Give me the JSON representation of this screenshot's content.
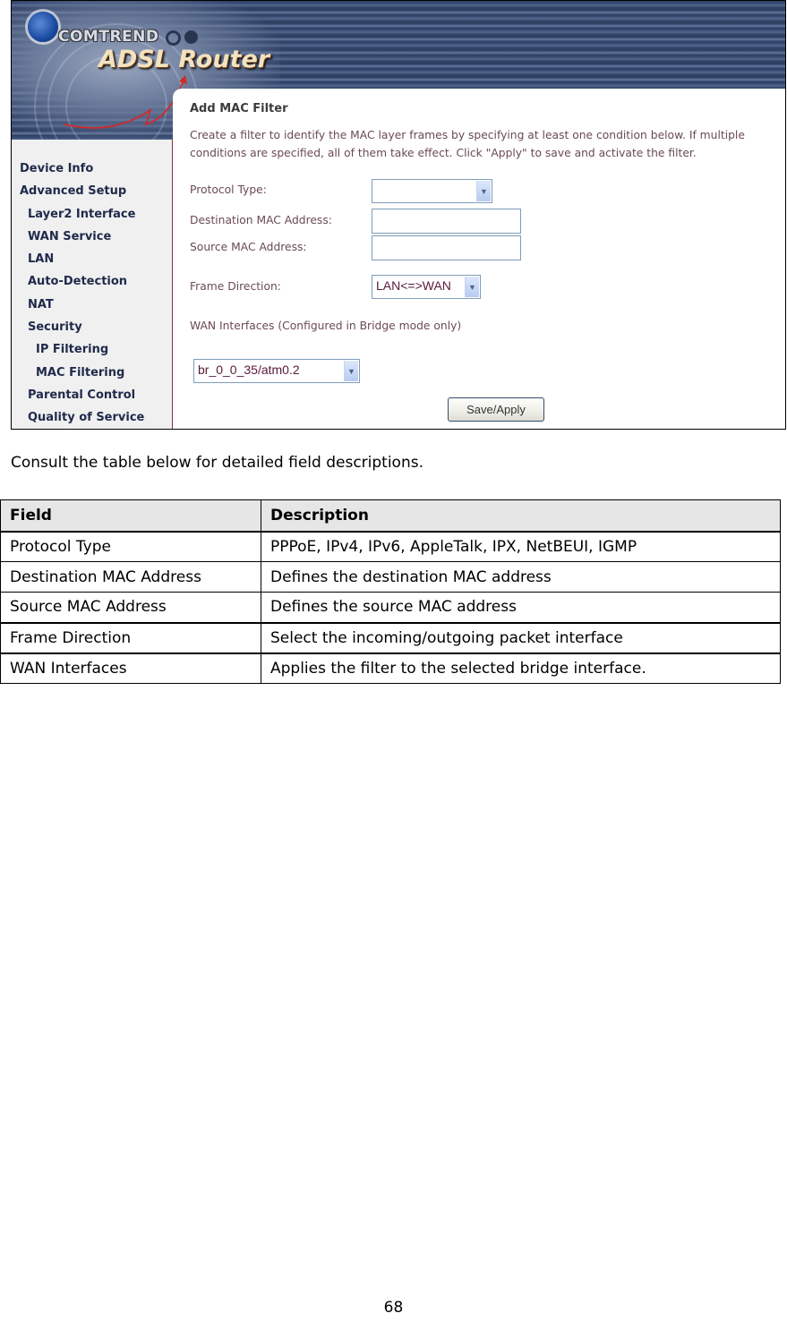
{
  "router_ui": {
    "brand": "COMTREND",
    "product": "ADSL Router",
    "sidebar": {
      "items": [
        {
          "label": "Device Info",
          "level": 1
        },
        {
          "label": "Advanced Setup",
          "level": 1
        },
        {
          "label": "Layer2 Interface",
          "level": 2
        },
        {
          "label": "WAN Service",
          "level": 2
        },
        {
          "label": "LAN",
          "level": 2
        },
        {
          "label": "Auto-Detection",
          "level": 2
        },
        {
          "label": "NAT",
          "level": 2
        },
        {
          "label": "Security",
          "level": 2
        },
        {
          "label": "IP Filtering",
          "level": 3
        },
        {
          "label": "MAC Filtering",
          "level": 3
        },
        {
          "label": "Parental Control",
          "level": 2
        },
        {
          "label": "Quality of Service",
          "level": 2
        }
      ]
    },
    "content": {
      "title": "Add MAC Filter",
      "intro": "Create a filter to identify the MAC layer frames by specifying at least one condition below. If multiple conditions are specified, all of them take effect. Click \"Apply\" to save and activate the filter.",
      "protocol_type_label": "Protocol Type:",
      "protocol_type_value": "",
      "dest_mac_label": "Destination MAC Address:",
      "dest_mac_value": "",
      "src_mac_label": "Source MAC Address:",
      "src_mac_value": "",
      "frame_direction_label": "Frame Direction:",
      "frame_direction_value": "LAN<=>WAN",
      "wan_interfaces_label": "WAN Interfaces (Configured in Bridge mode only)",
      "wan_interface_value": "br_0_0_35/atm0.2",
      "save_button": "Save/Apply"
    }
  },
  "doc": {
    "consult_text": "Consult the table below for detailed field descriptions.",
    "table": {
      "headers": [
        "Field",
        "Description"
      ],
      "rows": [
        [
          "Protocol Type",
          "PPPoE, IPv4, IPv6, AppleTalk, IPX, NetBEUI, IGMP"
        ],
        [
          "Destination MAC Address",
          "Defines the destination MAC address"
        ],
        [
          "Source MAC Address",
          "Defines the source MAC address"
        ],
        [
          "Frame Direction",
          "Select the incoming/outgoing packet interface"
        ],
        [
          "WAN Interfaces",
          "Applies the filter to the selected bridge interface."
        ]
      ]
    },
    "page_number": "68"
  }
}
